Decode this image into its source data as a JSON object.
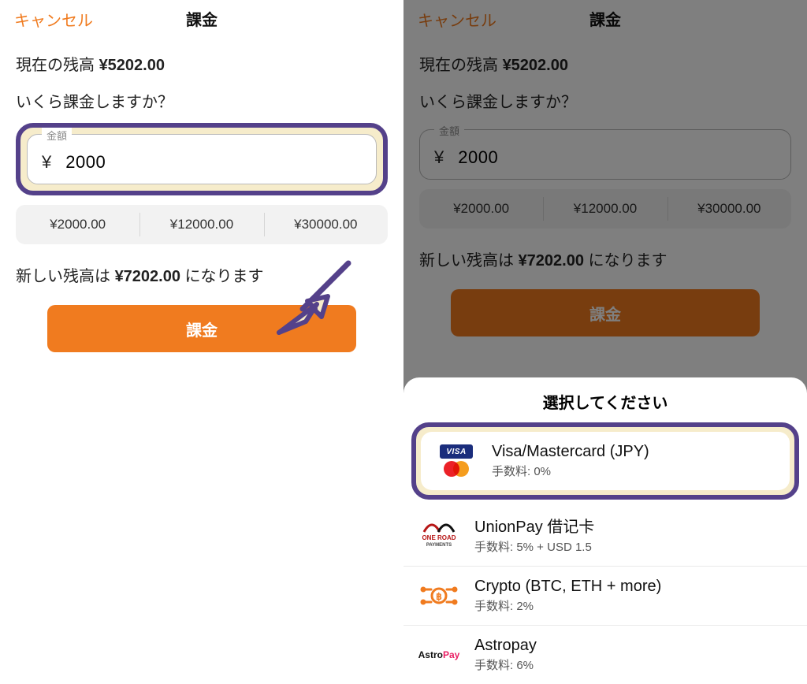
{
  "header": {
    "cancel": "キャンセル",
    "title": "課金"
  },
  "balance": {
    "label": "現在の残高 ",
    "value": "¥5202.00"
  },
  "prompt": "いくら課金しますか？",
  "amount_field": {
    "legend": "金額",
    "currency": "¥",
    "value": "2000"
  },
  "presets": [
    "¥2000.00",
    "¥12000.00",
    "¥30000.00"
  ],
  "new_balance": {
    "prefix": "新しい残高は ",
    "value": "¥7202.00",
    "suffix": " になります"
  },
  "cta": "課金",
  "sheet": {
    "title": "選択してください",
    "options": [
      {
        "name": "Visa/Mastercard (JPY)",
        "fee_label": "手数料: 0%"
      },
      {
        "name": "UnionPay 借记卡",
        "fee_label": "手数料: 5% + USD 1.5"
      },
      {
        "name": "Crypto (BTC, ETH + more)",
        "fee_label": "手数料: 2%"
      },
      {
        "name": "Astropay",
        "fee_label": "手数料: 6%"
      }
    ]
  },
  "icons": {
    "visa_text": "VISA",
    "oneroad_top": "ONE ROAD",
    "oneroad_sub": "PAYMENTS",
    "astro_a": "Astro",
    "astro_b": "Pay"
  }
}
